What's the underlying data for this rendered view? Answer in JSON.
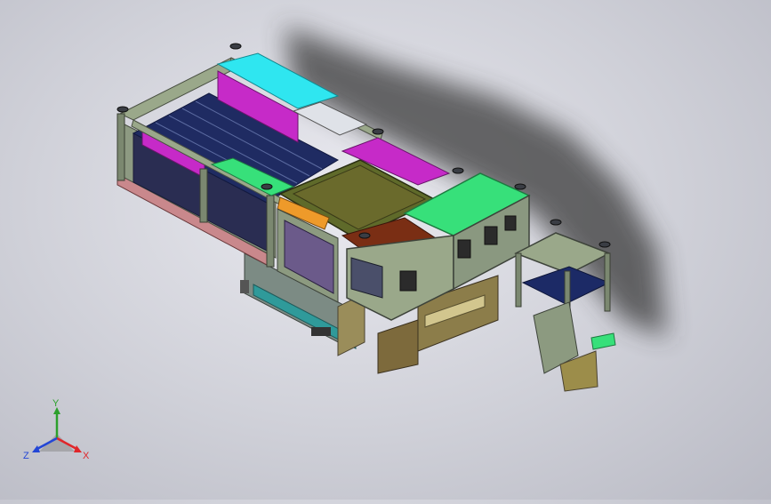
{
  "viewport": {
    "background_top": "#e9e9ef",
    "background_bottom": "#b9bac4"
  },
  "triad": {
    "x_label": "X",
    "y_label": "Y",
    "z_label": "Z",
    "x_color": "#e0262a",
    "y_color": "#2ca02c",
    "z_color": "#2346d6"
  },
  "model": {
    "panel_colors": {
      "cyan": "#2fe6f0",
      "magenta": "#c62ac8",
      "olive": "#6a6a2c",
      "green": "#37e07a",
      "brown": "#7a2e14",
      "orange": "#ee9a2a",
      "navy": "#1c2a66",
      "frame": "#9aa88a",
      "frame_dark": "#5b6150",
      "pink_rail": "#c9888c",
      "teal": "#2f9a9a"
    }
  }
}
